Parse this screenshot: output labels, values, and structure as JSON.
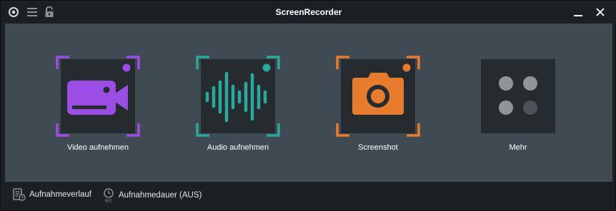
{
  "window": {
    "title": "ScreenRecorder"
  },
  "titlebar": {
    "icons": [
      "app-logo-icon",
      "menu-icon",
      "lock-icon"
    ],
    "minimize_label": "—",
    "close_label": "✕"
  },
  "tiles": [
    {
      "label": "Video aufnehmen",
      "icon": "video-camera-icon",
      "accent": "#9b4de6"
    },
    {
      "label": "Audio aufnehmen",
      "icon": "audio-waveform-icon",
      "accent": "#2ba79d"
    },
    {
      "label": "Screenshot",
      "icon": "camera-icon",
      "accent": "#e77b2e"
    },
    {
      "label": "Mehr",
      "icon": "more-dots-icon",
      "accent": "#8e969c"
    }
  ],
  "bottombar": {
    "history_label": "Aufnahmeverlauf",
    "duration_label": "Aufnahmedauer (AUS)"
  },
  "colors": {
    "background": "#3f4a52",
    "tile_background": "#262b30",
    "bar_background": "#1c2024"
  }
}
